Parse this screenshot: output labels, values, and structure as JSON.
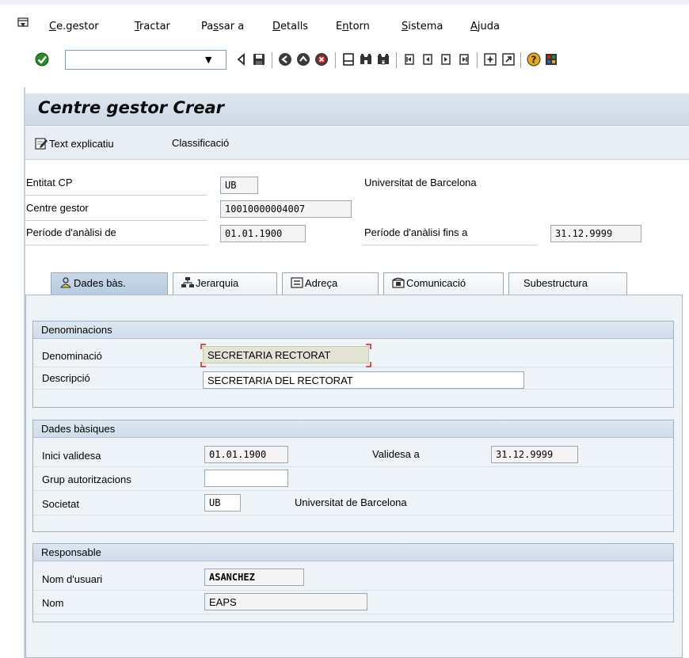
{
  "menu": {
    "items": [
      {
        "label": "Ce.gestor",
        "underline": "C",
        "rest": "e.gestor"
      },
      {
        "label": "Tractar",
        "underline": "T",
        "rest": "ractar"
      },
      {
        "label": "Passar a",
        "pre": "Pa",
        "underline": "s",
        "rest": "sar a"
      },
      {
        "label": "Detalls",
        "underline": "D",
        "rest": "etalls"
      },
      {
        "label": "Entorn",
        "pre": "E",
        "underline": "n",
        "rest": "torn"
      },
      {
        "label": "Sistema",
        "underline": "S",
        "rest": "istema"
      },
      {
        "label": "Ajuda",
        "underline": "A",
        "rest": "juda"
      }
    ]
  },
  "toolbar": {
    "command_value": "",
    "icons": [
      "enter-icon",
      "back-arrow-icon",
      "save-icon",
      "back-icon",
      "exit-icon",
      "cancel-icon",
      "print-icon",
      "find-icon",
      "find-next-icon",
      "first-page-icon",
      "previous-page-icon",
      "next-page-icon",
      "last-page-icon",
      "create-session-icon",
      "shortcut-icon",
      "help-icon",
      "layout-icon"
    ]
  },
  "title": "Centre gestor Crear",
  "app_toolbar": {
    "text_button": "Text explicatiu",
    "class_button": "Classificació"
  },
  "header": {
    "entitat_label": "Entitat CP",
    "entitat_value": "UB",
    "entitat_desc": "Universitat de Barcelona",
    "centre_label": "Centre gestor",
    "centre_value": "10010000004007",
    "periode_de_label": "Període d'anàlisi de",
    "periode_de_value": "01.01.1900",
    "periode_fins_label": "Període d'anàlisi fins a",
    "periode_fins_value": "31.12.9999"
  },
  "tabs": [
    {
      "label": "Dades bàs.",
      "active": true
    },
    {
      "label": "Jerarquia",
      "active": false
    },
    {
      "label": "Adreça",
      "active": false
    },
    {
      "label": "Comunicació",
      "active": false
    },
    {
      "label": "Subestructura",
      "active": false
    }
  ],
  "groups": {
    "denominacions": {
      "title": "Denominacions",
      "denominacio_label": "Denominació",
      "denominacio_value": "SECRETARIA RECTORAT",
      "descripcio_label": "Descripció",
      "descripcio_value": "SECRETARIA DEL RECTORAT"
    },
    "dades_basiques": {
      "title": "Dades bàsiques",
      "inici_label": "Inici validesa",
      "inici_value": "01.01.1900",
      "validesa_label": "Validesa a",
      "validesa_value": "31.12.9999",
      "grup_label": "Grup autoritzacions",
      "grup_value": "",
      "societat_label": "Societat",
      "societat_value": "UB",
      "societat_desc": "Universitat de Barcelona"
    },
    "responsable": {
      "title": "Responsable",
      "usuari_label": "Nom d'usuari",
      "usuari_value": "ASANCHEZ",
      "nom_label": "Nom",
      "nom_value": "EAPS"
    }
  },
  "colors": {
    "focus_marker": "#d42020",
    "enter_green": "#2a8a2a"
  }
}
